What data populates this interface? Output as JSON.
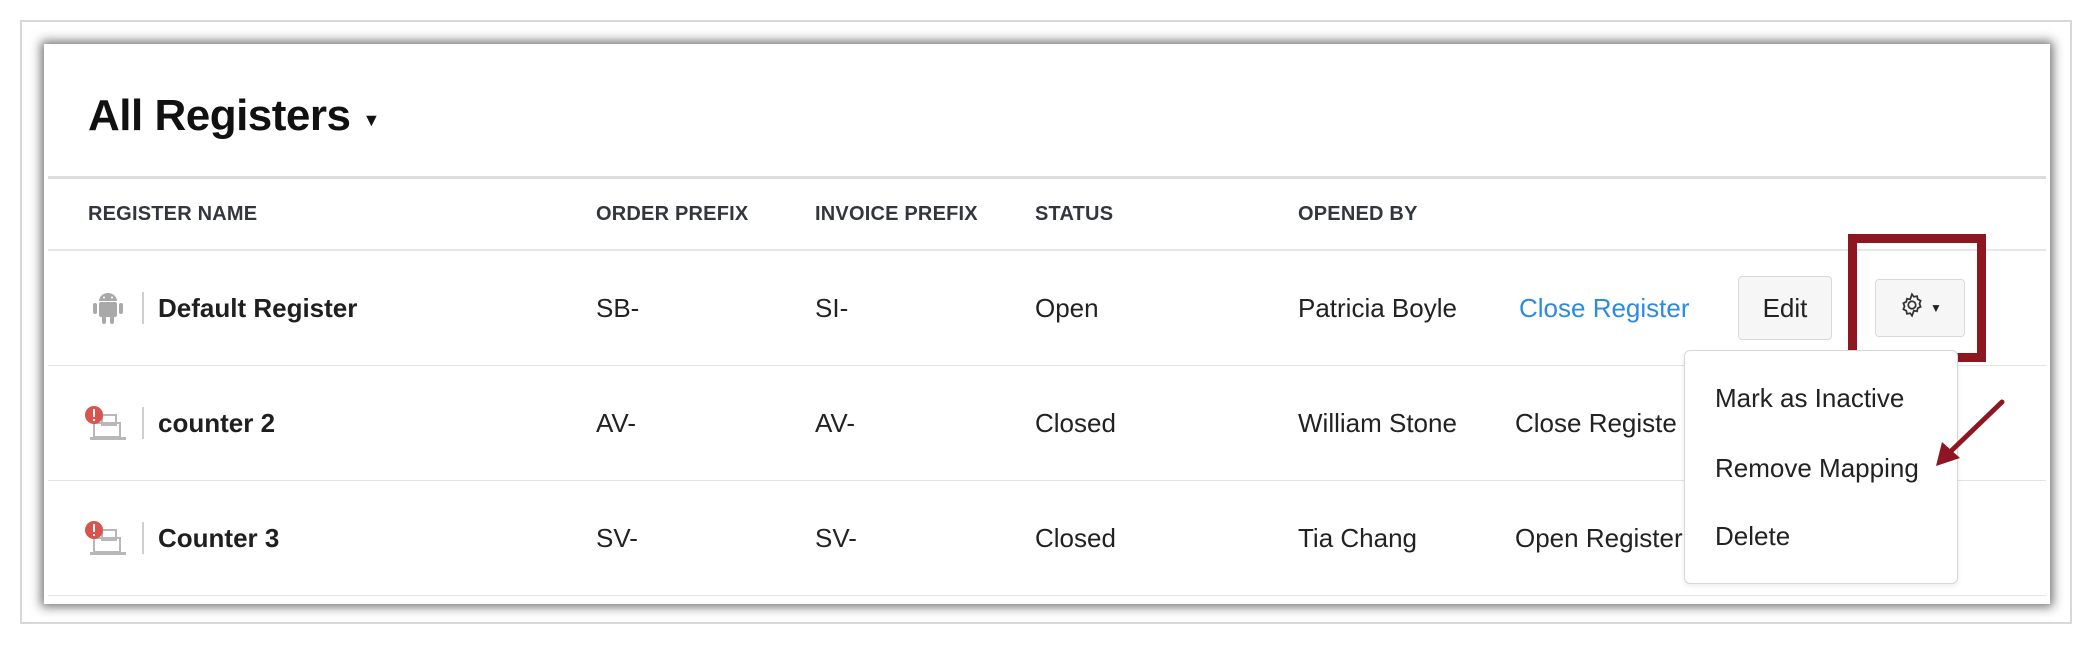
{
  "header": {
    "title": "All Registers"
  },
  "table": {
    "columns": [
      "REGISTER NAME",
      "ORDER PREFIX",
      "INVOICE PREFIX",
      "STATUS",
      "OPENED BY"
    ],
    "rows": [
      {
        "icon": "android-icon",
        "name": "Default Register",
        "order_prefix": "SB-",
        "invoice_prefix": "SI-",
        "status": "Open",
        "opened_by": "Patricia Boyle",
        "action": "Close Register",
        "edit": "Edit"
      },
      {
        "icon": "device-warning-icon",
        "name": "counter 2",
        "order_prefix": "AV-",
        "invoice_prefix": "AV-",
        "status": "Closed",
        "opened_by": "William Stone",
        "action": "Close Registe"
      },
      {
        "icon": "device-warning-icon",
        "name": "Counter 3",
        "order_prefix": "SV-",
        "invoice_prefix": "SV-",
        "status": "Closed",
        "opened_by": "Tia Chang",
        "action": "Open Register"
      }
    ]
  },
  "dropdown": {
    "items": [
      "Mark as Inactive",
      "Remove Mapping",
      "Delete"
    ]
  },
  "colors": {
    "link": "#2b8ae3",
    "highlight": "#8e1620",
    "warning": "#d9534f"
  }
}
